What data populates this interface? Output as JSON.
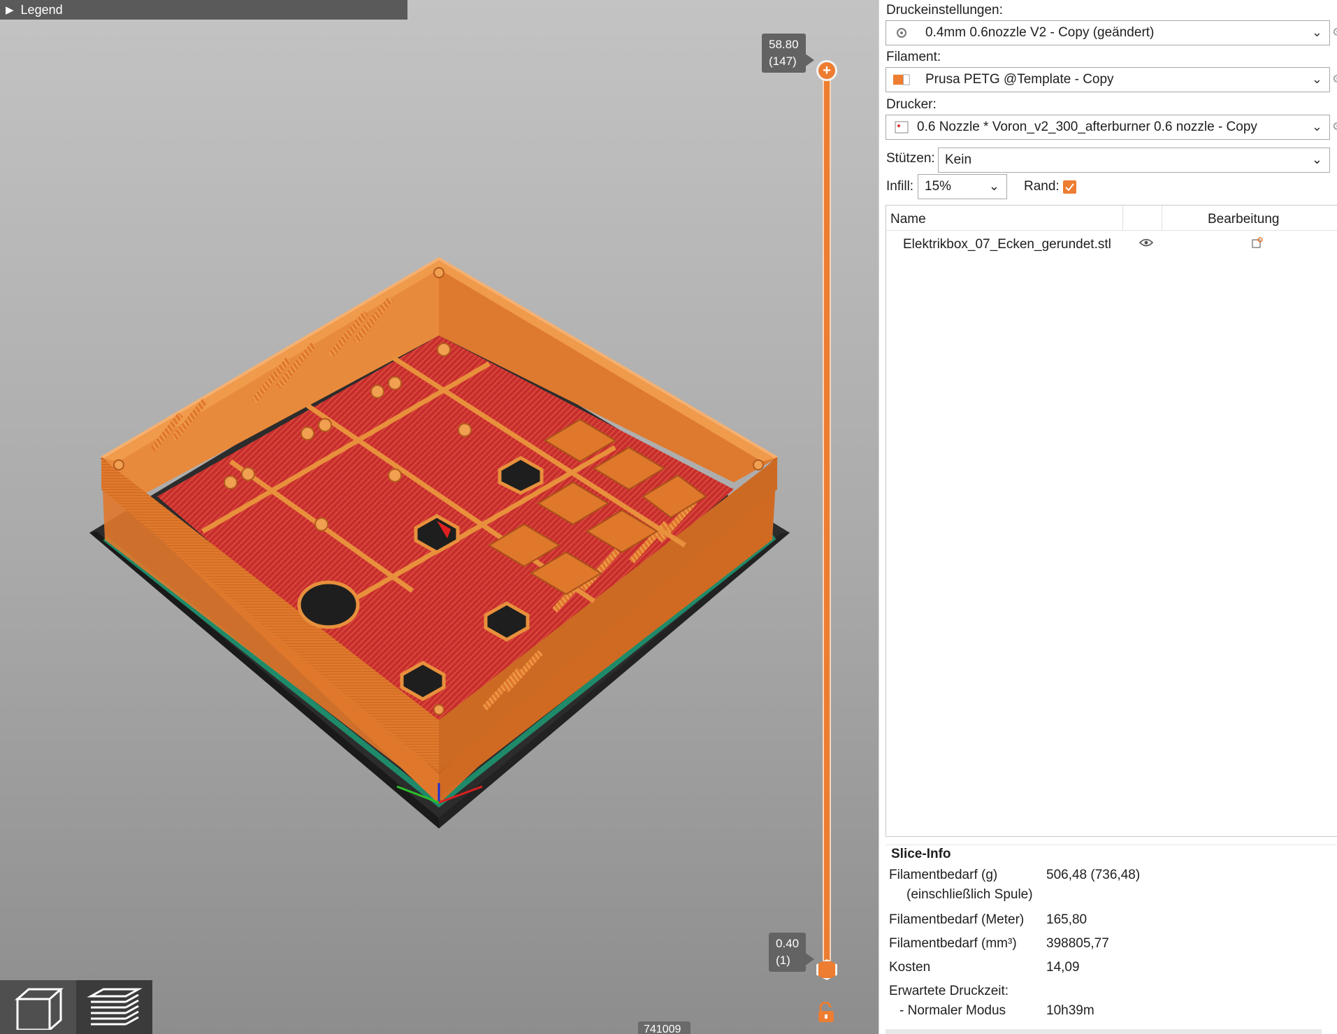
{
  "viewport": {
    "legend_label": "Legend",
    "layer_slider": {
      "top_height": "58.80",
      "top_layer": "(147)",
      "bottom_height": "0.40",
      "bottom_layer": "(1)",
      "position_fraction": 1.0
    },
    "move_counter": "741009",
    "view_buttons": [
      {
        "name": "3d-view",
        "active": false
      },
      {
        "name": "preview",
        "active": true
      }
    ],
    "colors": {
      "accent": "#ed7d31",
      "perimeter": "#e0782c",
      "infill": "#c62d2d",
      "bed": "#2c2c2c",
      "skirt": "#1f8a6a",
      "background_top": "#c3c3c3",
      "background_bottom": "#8d8d8d"
    }
  },
  "sidebar": {
    "print_settings": {
      "label": "Druckeinstellungen:",
      "value": "0.4mm 0.6nozzle V2 - Copy (geändert)",
      "icon": "cog-icon"
    },
    "filament": {
      "label": "Filament:",
      "value": "Prusa PETG @Template - Copy",
      "icon": "filament-color-icon",
      "color": "#ed7d31"
    },
    "printer": {
      "label": "Drucker:",
      "value": "0.6 Nozzle * Voron_v2_300_afterburner 0.6 nozzle - Copy",
      "icon": "printer-icon"
    },
    "supports": {
      "label": "Stützen:",
      "value": "Kein"
    },
    "infill": {
      "label": "Infill:",
      "value": "15%"
    },
    "brim": {
      "label": "Rand:",
      "checked": true
    },
    "object_list": {
      "columns": {
        "name": "Name",
        "edit": "Bearbeitung"
      },
      "objects": [
        {
          "name": "Elektrikbox_07_Ecken_gerundet.stl"
        }
      ]
    },
    "slice_info": {
      "title": "Slice-Info",
      "rows": [
        {
          "label": "Filamentbedarf (g)",
          "sublabel": "(einschließlich Spule)",
          "value": "506,48 (736,48)"
        },
        {
          "label": "Filamentbedarf (Meter)",
          "value": "165,80"
        },
        {
          "label": "Filamentbedarf (mm³)",
          "value": "398805,77"
        },
        {
          "label": "Kosten",
          "value": "14,09"
        },
        {
          "label": "Erwartete Druckzeit:",
          "value": ""
        },
        {
          "label": "- Normaler Modus",
          "value": "10h39m"
        }
      ]
    }
  }
}
